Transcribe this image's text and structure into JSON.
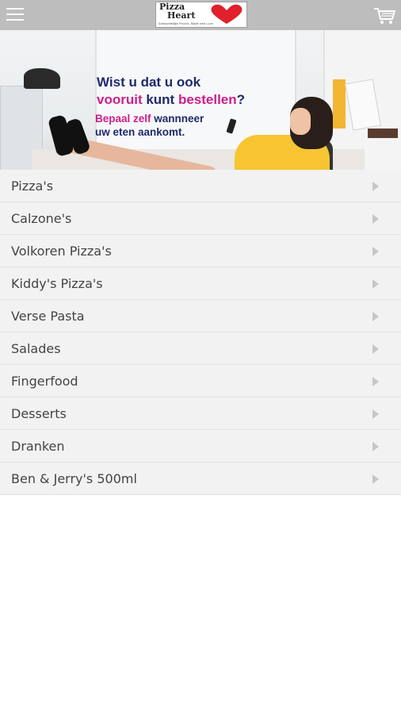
{
  "header": {
    "logo_name_line1": "Pizza",
    "logo_name_line2": "Heart",
    "logo_tagline": "Ambachtelijke Pizza's, Made with Love",
    "menu_icon": "hamburger-icon",
    "cart_icon": "shopping-cart-icon"
  },
  "banner": {
    "headline_part1": "Wist u dat u ook",
    "headline_part2_highlight": "vooruit",
    "headline_part3": " kunt ",
    "headline_part4_highlight": "bestellen",
    "headline_part5": "?",
    "sub_highlight": "Bepaal zelf",
    "sub_rest": " wannneer",
    "sub_line2": "uw eten aankomt."
  },
  "categories": [
    {
      "label": "Pizza's"
    },
    {
      "label": "Calzone's"
    },
    {
      "label": "Volkoren Pizza's"
    },
    {
      "label": "Kiddy's Pizza's"
    },
    {
      "label": "Verse Pasta"
    },
    {
      "label": "Salades"
    },
    {
      "label": "Fingerfood"
    },
    {
      "label": "Desserts"
    },
    {
      "label": "Dranken"
    },
    {
      "label": "Ben & Jerry's 500ml"
    }
  ],
  "colors": {
    "topbar": "#bdbdbd",
    "list_bg": "#f2f2f2",
    "headline": "#1f2a6b",
    "highlight": "#cc1f8a",
    "logo_heart": "#e0202a"
  }
}
